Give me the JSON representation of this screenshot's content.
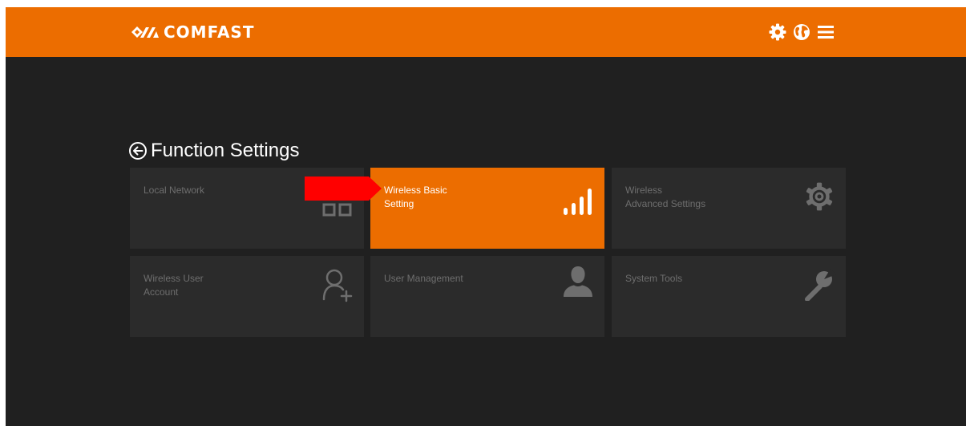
{
  "header": {
    "brand": "COMFAST",
    "brand_color": "#ec6d00",
    "icons": [
      "gear-icon",
      "globe-icon",
      "menu-icon"
    ]
  },
  "page": {
    "title": "Function Settings",
    "back_icon": "circle-arrow-left-icon"
  },
  "tiles": [
    {
      "label_lines": [
        "Local Network"
      ],
      "icon": "two-squares-icon",
      "active": false
    },
    {
      "label_lines": [
        "Wireless Basic",
        "Setting"
      ],
      "icon": "signal-bars-icon",
      "active": true
    },
    {
      "label_lines": [
        "Wireless",
        "Advanced Settings"
      ],
      "icon": "gear-icon",
      "active": false
    },
    {
      "label_lines": [
        "Wireless User",
        "Account"
      ],
      "icon": "add-user-icon",
      "active": false
    },
    {
      "label_lines": [
        "User Management"
      ],
      "icon": "person-icon",
      "active": false
    },
    {
      "label_lines": [
        "System Tools"
      ],
      "icon": "wrench-icon",
      "active": false
    }
  ],
  "annotation": {
    "icon": "red-arrow-icon",
    "color": "#ff0000"
  }
}
